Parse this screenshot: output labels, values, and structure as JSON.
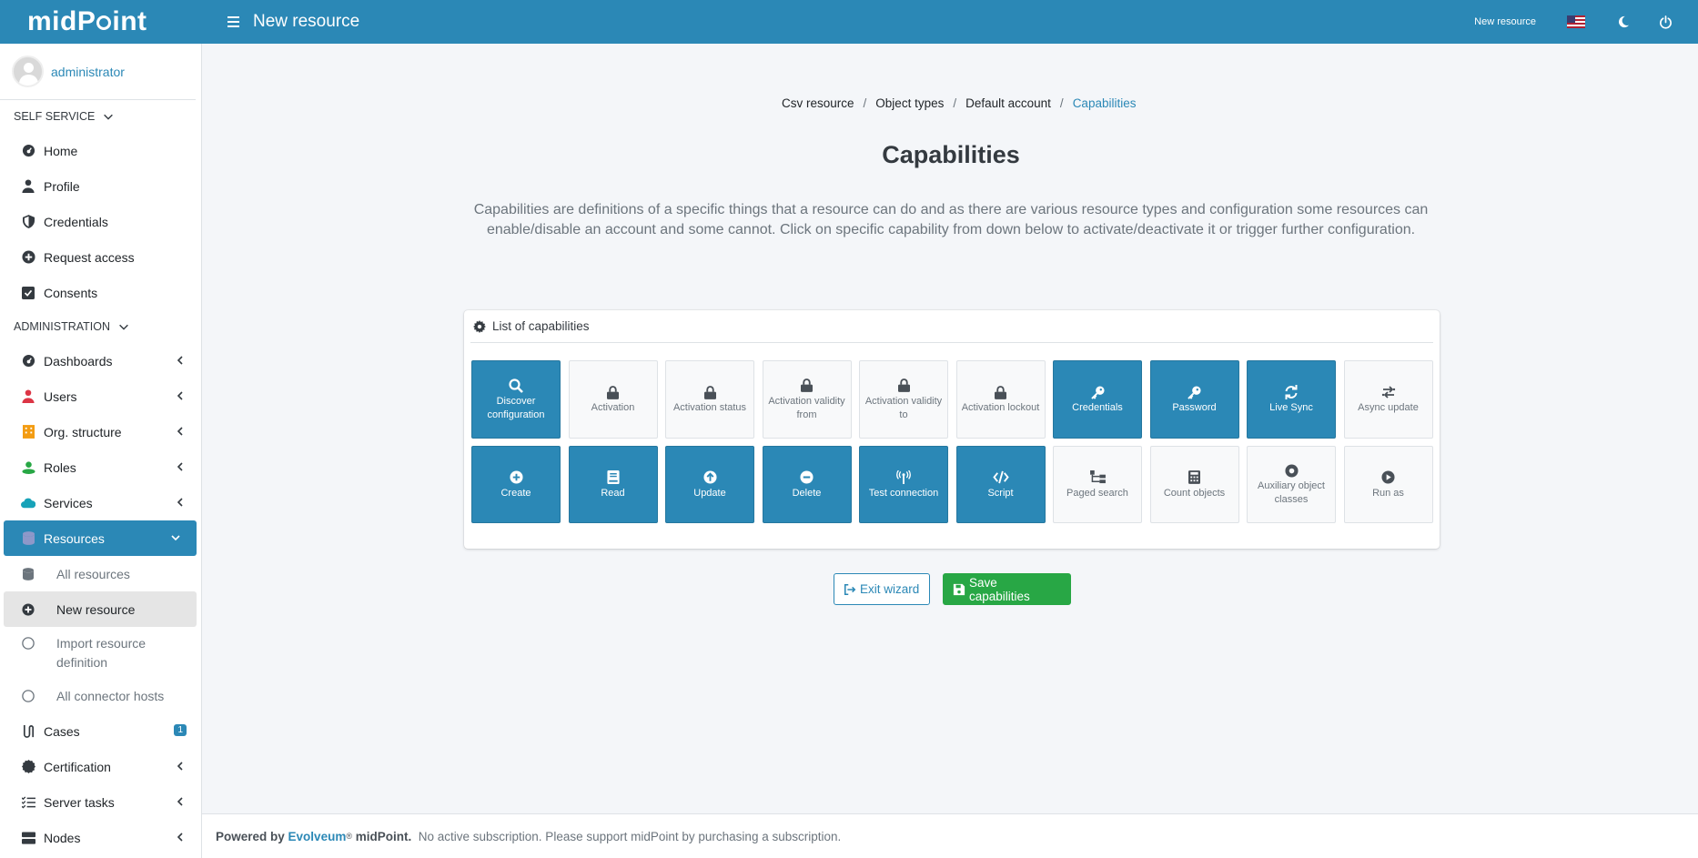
{
  "header": {
    "logo": "midPoint",
    "page_title": "New resource",
    "crumb": "New resource"
  },
  "user": {
    "name": "administrator"
  },
  "sidebar": {
    "self_service_label": "SELF SERVICE",
    "self_service": [
      {
        "label": "Home",
        "icon": "dashboard-icon"
      },
      {
        "label": "Profile",
        "icon": "user-icon"
      },
      {
        "label": "Credentials",
        "icon": "shield-icon"
      },
      {
        "label": "Request access",
        "icon": "plus-circle-icon"
      },
      {
        "label": "Consents",
        "icon": "check-square-icon"
      }
    ],
    "admin_label": "ADMINISTRATION",
    "admin": [
      {
        "label": "Dashboards",
        "icon": "dashboard-icon"
      },
      {
        "label": "Users",
        "icon": "user-icon",
        "color": "#dc3545"
      },
      {
        "label": "Org. structure",
        "icon": "building-icon",
        "color": "#f39c12"
      },
      {
        "label": "Roles",
        "icon": "role-icon",
        "color": "#28a745"
      },
      {
        "label": "Services",
        "icon": "cloud-icon",
        "color": "#17a2b8"
      },
      {
        "label": "Resources",
        "icon": "database-icon"
      }
    ],
    "resources_sub": [
      {
        "label": "All resources",
        "icon": "database-icon"
      },
      {
        "label": "New resource",
        "icon": "plus-circle-icon"
      },
      {
        "label": "Import resource definition",
        "icon": "circle-icon"
      },
      {
        "label": "All connector hosts",
        "icon": "circle-icon"
      }
    ],
    "cases": {
      "label": "Cases",
      "badge": "1"
    },
    "rest": [
      {
        "label": "Certification",
        "icon": "certificate-icon"
      },
      {
        "label": "Server tasks",
        "icon": "tasks-icon"
      },
      {
        "label": "Nodes",
        "icon": "server-icon"
      }
    ]
  },
  "breadcrumb": [
    "Csv resource",
    "Object types",
    "Default account",
    "Capabilities"
  ],
  "main": {
    "title": "Capabilities",
    "description": "Capabilities are definitions of a specific things that a resource can do and as there are various resource types and configuration some resources can enable/disable an account and some cannot. Click on specific capability from down below to activate/deactivate it or trigger further configuration.",
    "card_title": "List of capabilities"
  },
  "capabilities": [
    {
      "label": "Discover configuration",
      "enabled": true,
      "icon": "search-icon"
    },
    {
      "label": "Activation",
      "enabled": false,
      "icon": "lock-icon"
    },
    {
      "label": "Activation status",
      "enabled": false,
      "icon": "lock-icon"
    },
    {
      "label": "Activation validity from",
      "enabled": false,
      "icon": "lock-icon"
    },
    {
      "label": "Activation validity to",
      "enabled": false,
      "icon": "lock-icon"
    },
    {
      "label": "Activation lockout",
      "enabled": false,
      "icon": "lock-icon"
    },
    {
      "label": "Credentials",
      "enabled": true,
      "icon": "key-icon"
    },
    {
      "label": "Password",
      "enabled": true,
      "icon": "key-icon"
    },
    {
      "label": "Live Sync",
      "enabled": true,
      "icon": "sync-icon"
    },
    {
      "label": "Async update",
      "enabled": false,
      "icon": "async-icon"
    },
    {
      "label": "Create",
      "enabled": true,
      "icon": "plus-circle-icon"
    },
    {
      "label": "Read",
      "enabled": true,
      "icon": "book-icon"
    },
    {
      "label": "Update",
      "enabled": true,
      "icon": "arrow-up-circle-icon"
    },
    {
      "label": "Delete",
      "enabled": true,
      "icon": "minus-circle-icon"
    },
    {
      "label": "Test connection",
      "enabled": true,
      "icon": "antenna-icon"
    },
    {
      "label": "Script",
      "enabled": true,
      "icon": "code-icon"
    },
    {
      "label": "Paged search",
      "enabled": false,
      "icon": "sitemap-icon"
    },
    {
      "label": "Count objects",
      "enabled": false,
      "icon": "calculator-icon"
    },
    {
      "label": "Auxiliary object classes",
      "enabled": false,
      "icon": "dot-circle-icon"
    },
    {
      "label": "Run as",
      "enabled": false,
      "icon": "play-circle-icon"
    }
  ],
  "actions": {
    "exit": "Exit wizard",
    "save": "Save capabilities"
  },
  "footer": {
    "powered_prefix": "Powered by",
    "brand": "Evolveum",
    "reg": "®",
    "product": "midPoint.",
    "note": "No active subscription. Please support midPoint by purchasing a subscription."
  },
  "colors": {
    "primary": "#2b88b6",
    "success": "#28a745"
  }
}
